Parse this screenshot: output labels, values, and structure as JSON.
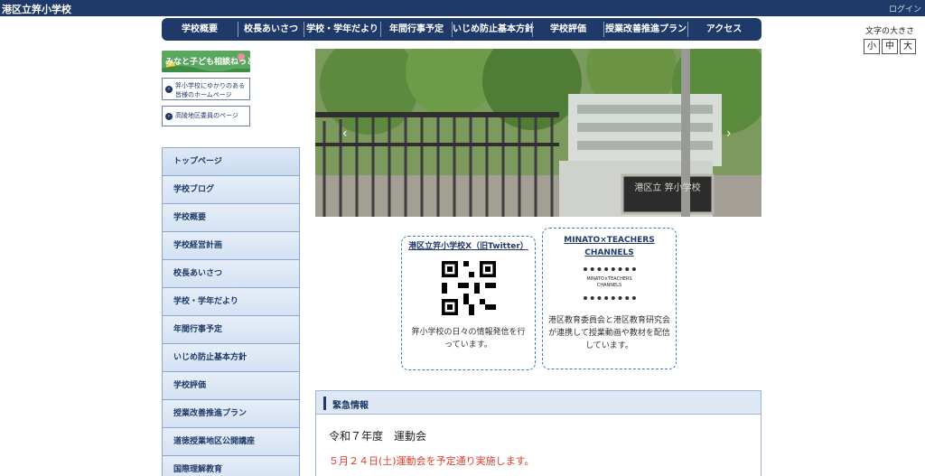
{
  "site": {
    "title": "港区立笄小学校",
    "login": "ログイン"
  },
  "gnav": [
    "学校概要",
    "校長あいさつ",
    "学校・学年だより",
    "年間行事予定",
    "いじめ防止基本方針",
    "学校評価",
    "授業改善推進プラン",
    "アクセス"
  ],
  "fontsize": {
    "label": "文字の大きさ",
    "small": "小",
    "medium": "中",
    "large": "大"
  },
  "banners": {
    "soudan": "みなと子ども相談ねっと",
    "link1": "笄小学校にゆかりのある皆様のホームページ",
    "link2": "高陵地区委員のページ"
  },
  "sidenav": [
    "トップページ",
    "学校ブログ",
    "学校概要",
    "学校経営計画",
    "校長あいさつ",
    "学校・学年だより",
    "年間行事予定",
    "いじめ防止基本方針",
    "学校評価",
    "授業改善推進プラン",
    "道徳授業地区公開講座",
    "国際理解教育"
  ],
  "hero": {
    "plate": "港区立 笄小学校"
  },
  "card_x": {
    "title": "港区立笄小学校X（旧Twitter）",
    "desc": "笄小学校の日々の情報発信を行っています。"
  },
  "card_teachers": {
    "title": "MINATO×TEACHERS CHANNELS",
    "thumb": "MINATO×TEACHERS CHANNELS",
    "desc": "港区教育委員会と港区教育研究会が連携して授業動画や教材を配信しています。"
  },
  "urgent": {
    "heading": "緊急情報",
    "title": "令和７年度　運動会",
    "note": "５月２４日(土)運動会を予定通り実施します。"
  },
  "colors": {
    "navy": "#1f3a68",
    "accent": "#3c7ac0",
    "alert": "#e03a2a"
  }
}
